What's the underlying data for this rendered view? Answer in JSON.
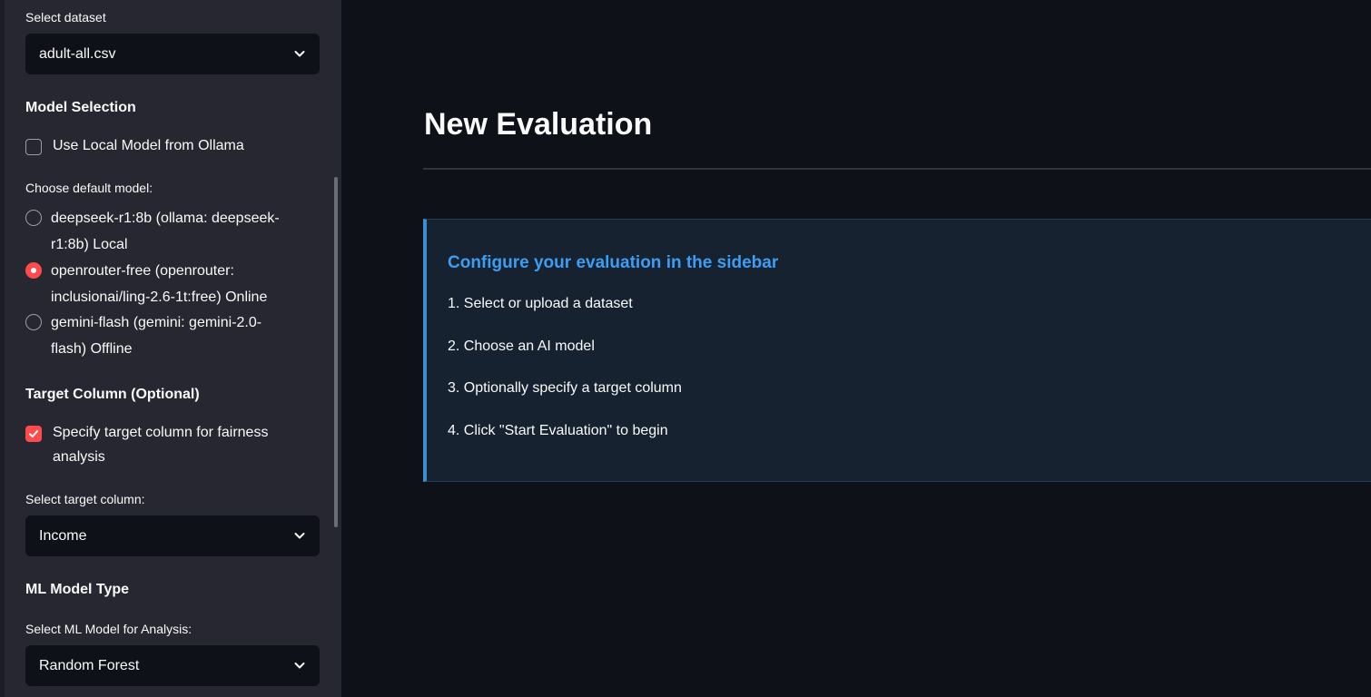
{
  "sidebar": {
    "dataset_label": "Select dataset",
    "dataset_value": "adult-all.csv",
    "model_selection_title": "Model Selection",
    "use_local_label": "Use Local Model from Ollama",
    "use_local_checked": false,
    "default_model_label": "Choose default model:",
    "models": [
      {
        "line1": "deepseek-r1:8b (ollama: deepseek-",
        "line2": "r1:8b) Local",
        "selected": false
      },
      {
        "line1": "openrouter-free (openrouter:",
        "line2": "inclusionai/ling-2.6-1t:free) Online",
        "selected": true
      },
      {
        "line1": "gemini-flash (gemini: gemini-2.0-",
        "line2": "flash) Offline",
        "selected": false
      }
    ],
    "target_section_title": "Target Column (Optional)",
    "specify_target_line1": "Specify target column for fairness",
    "specify_target_line2": "analysis",
    "specify_target_checked": true,
    "target_select_label": "Select target column:",
    "target_select_value": "Income",
    "ml_section_title": "ML Model Type",
    "ml_select_label": "Select ML Model for Analysis:",
    "ml_select_value": "Random Forest"
  },
  "main": {
    "title": "New Evaluation",
    "info": {
      "heading": "Configure your evaluation in the sidebar",
      "steps": [
        "1. Select or upload a dataset",
        "2. Choose an AI model",
        "3. Optionally specify a target column",
        "4. Click \"Start Evaluation\" to begin"
      ]
    }
  },
  "colors": {
    "accent": "#ff4b4b",
    "info_blue": "#3d9df3",
    "sidebar_bg": "#262730",
    "main_bg": "#0e1117"
  }
}
